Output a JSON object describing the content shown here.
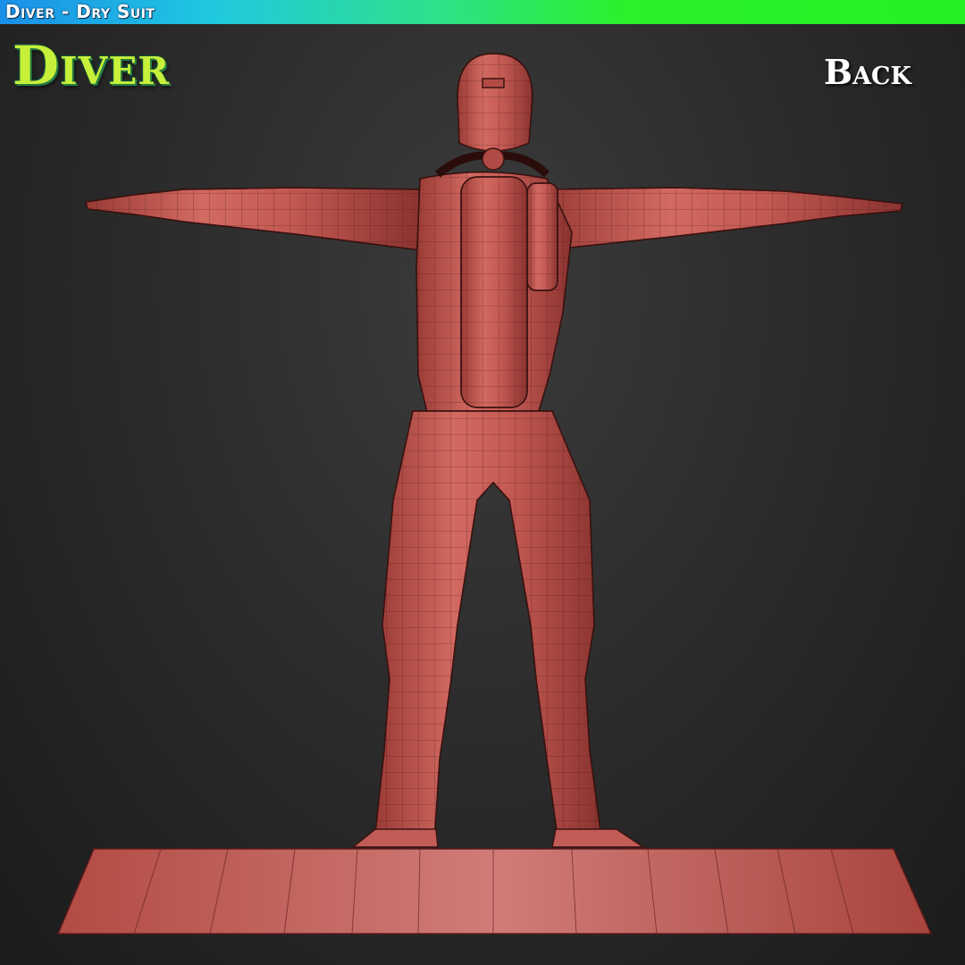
{
  "header": {
    "title": "Diver - Dry Suit"
  },
  "logo": {
    "text": "Diver"
  },
  "view": {
    "label": "Back"
  },
  "colors": {
    "accent_gradient_start": "#1a8fe8",
    "accent_gradient_end": "#24f024",
    "model": "#c85a54",
    "wireframe": "#3a1210",
    "background": "#2a2a2a"
  },
  "icons": [
    "diver-model-illustration"
  ]
}
